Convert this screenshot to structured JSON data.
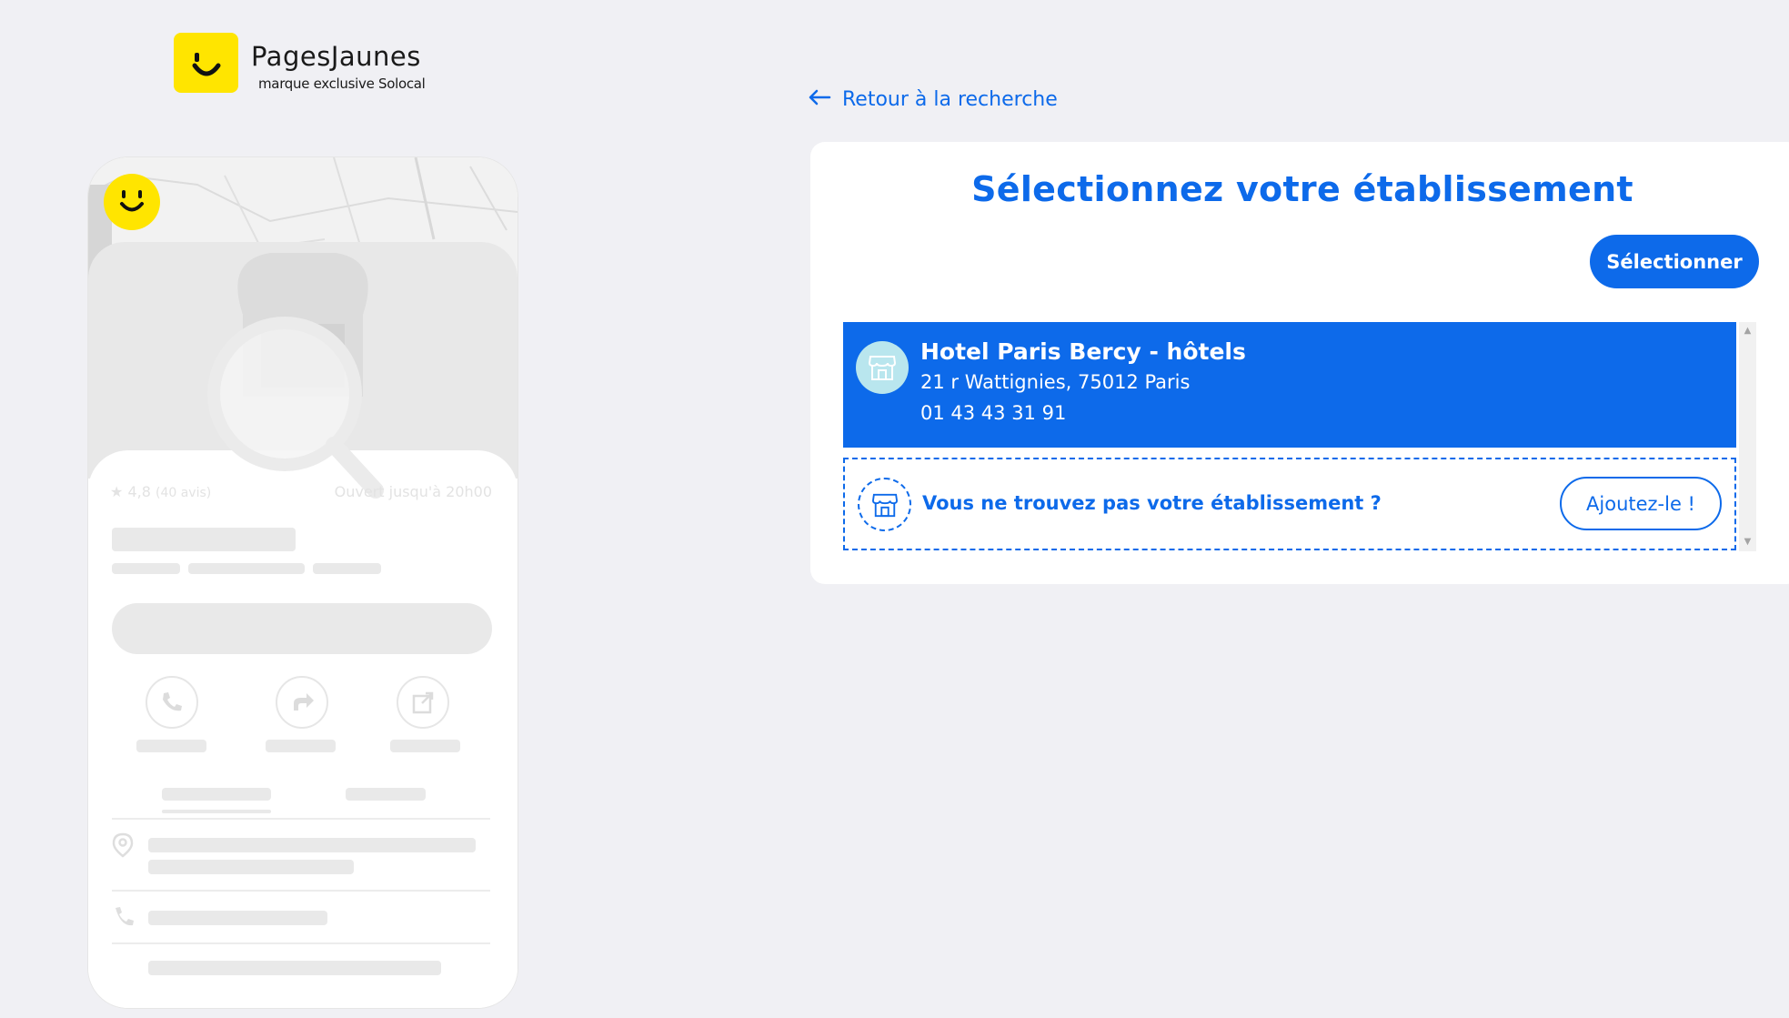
{
  "logo": {
    "brand": "PagesJaunes",
    "tagline": "marque exclusive Solocal"
  },
  "phone_preview": {
    "rating": "4,8",
    "reviews": "(40 avis)",
    "hours": "Ouvert jusqu'à 20h00"
  },
  "nav": {
    "back_label": "Retour à la recherche"
  },
  "card": {
    "title": "Sélectionnez votre établissement",
    "select_button": "Sélectionner",
    "results": [
      {
        "name": "Hotel Paris Bercy - hôtels",
        "address": "21 r Wattignies, 75012 Paris",
        "phone": "01 43 43 31 91"
      }
    ],
    "not_found_text": "Vous ne trouvez pas votre établissement ?",
    "add_button": "Ajoutez-le !"
  },
  "colors": {
    "accent": "#0d6aea",
    "brand_yellow": "#ffe500",
    "background": "#f0f0f4",
    "store_icon_bg": "#b9e6ee"
  },
  "icons": {
    "back": "arrow-left-icon",
    "store": "store-icon",
    "scroll_up": "triangle-up-icon",
    "scroll_down": "triangle-down-icon"
  }
}
